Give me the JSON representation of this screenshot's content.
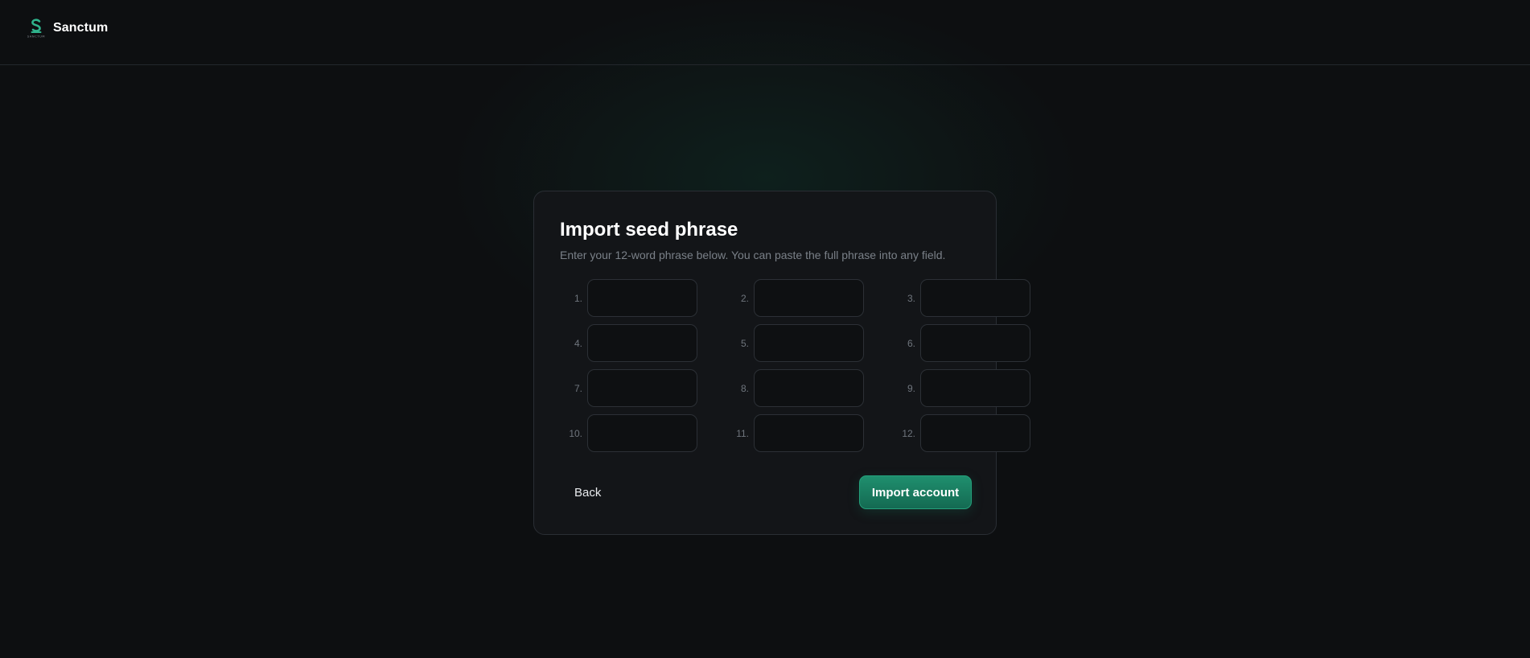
{
  "header": {
    "brand_name": "Sanctum",
    "logo_text": "SANCTUM",
    "logo_icon": "sanctum-logo"
  },
  "card": {
    "title": "Import seed phrase",
    "subtitle": "Enter your 12-word phrase below. You can paste the full phrase into any field.",
    "words": [
      {
        "number": "1.",
        "value": "",
        "placeholder": ""
      },
      {
        "number": "2.",
        "value": "",
        "placeholder": ""
      },
      {
        "number": "3.",
        "value": "",
        "placeholder": ""
      },
      {
        "number": "4.",
        "value": "",
        "placeholder": ""
      },
      {
        "number": "5.",
        "value": "",
        "placeholder": ""
      },
      {
        "number": "6.",
        "value": "",
        "placeholder": ""
      },
      {
        "number": "7.",
        "value": "",
        "placeholder": ""
      },
      {
        "number": "8.",
        "value": "",
        "placeholder": ""
      },
      {
        "number": "9.",
        "value": "",
        "placeholder": ""
      },
      {
        "number": "10.",
        "value": "",
        "placeholder": ""
      },
      {
        "number": "11.",
        "value": "",
        "placeholder": ""
      },
      {
        "number": "12.",
        "value": "",
        "placeholder": ""
      }
    ],
    "back_label": "Back",
    "import_label": "Import account"
  },
  "colors": {
    "background": "#0d0f11",
    "card": "#131518",
    "accent": "#1f8f6e",
    "accent_logo": "#2fb38c"
  }
}
